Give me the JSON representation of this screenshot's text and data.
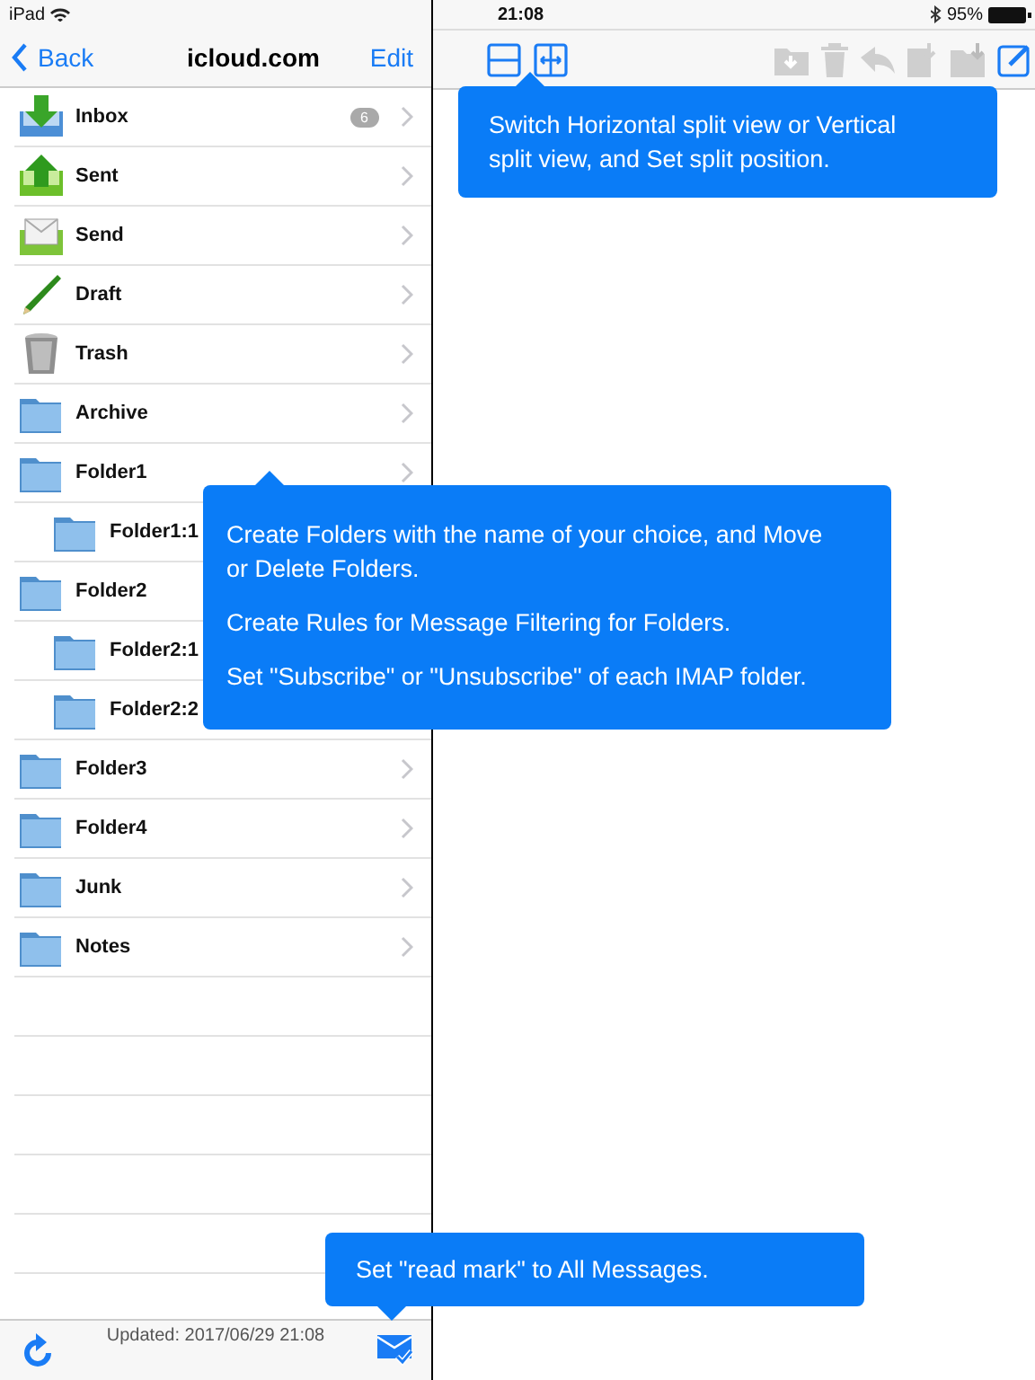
{
  "status_bar": {
    "device": "iPad",
    "time": "21:08",
    "battery": "95%"
  },
  "nav": {
    "back": "Back",
    "title": "icloud.com",
    "edit": "Edit"
  },
  "folders": [
    {
      "name": "Inbox",
      "kind": "inbox",
      "badge": "6"
    },
    {
      "name": "Sent",
      "kind": "sent"
    },
    {
      "name": "Send",
      "kind": "send"
    },
    {
      "name": "Draft",
      "kind": "draft"
    },
    {
      "name": "Trash",
      "kind": "trash"
    },
    {
      "name": "Archive",
      "kind": "folder"
    },
    {
      "name": "Folder1",
      "kind": "folder",
      "children": [
        {
          "name": "Folder1:1",
          "kind": "folder"
        }
      ]
    },
    {
      "name": "Folder2",
      "kind": "folder",
      "children": [
        {
          "name": "Folder2:1",
          "kind": "folder"
        },
        {
          "name": "Folder2:2",
          "kind": "folder"
        }
      ]
    },
    {
      "name": "Folder3",
      "kind": "folder"
    },
    {
      "name": "Folder4",
      "kind": "folder"
    },
    {
      "name": "Junk",
      "kind": "folder"
    },
    {
      "name": "Notes",
      "kind": "folder"
    }
  ],
  "footer": {
    "updated": "Updated: 2017/06/29 21:08"
  },
  "tooltips": [
    {
      "kind": "split",
      "paragraphs": [
        "Switch  Horizontal split view or Vertical split view, and Set split position."
      ]
    },
    {
      "kind": "folders",
      "paragraphs": [
        "Create Folders with the name of your choice, and Move or Delete Folders.",
        "Create Rules for Message Filtering for Folders.",
        "Set \"Subscribe\" or \"Unsubscribe\" of each IMAP folder."
      ]
    },
    {
      "kind": "readmark",
      "paragraphs": [
        "Set \"read mark\" to All Messages."
      ]
    }
  ]
}
